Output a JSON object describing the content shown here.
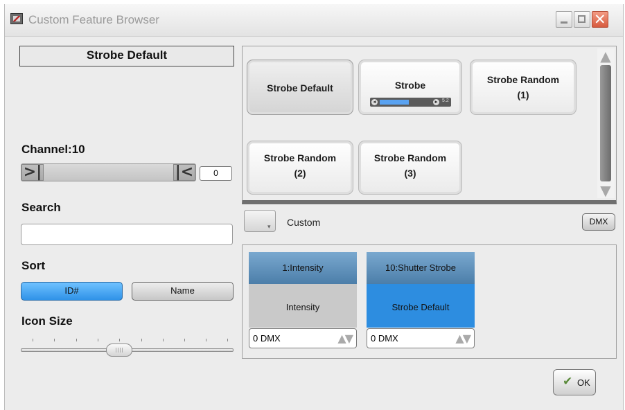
{
  "window": {
    "title": "Custom Feature Browser"
  },
  "left": {
    "current_feature": "Strobe Default",
    "channel_label": "Channel:10",
    "channel_value": "0",
    "search_label": "Search",
    "search_value": "",
    "sort_label": "Sort",
    "sort_id": "ID#",
    "sort_name": "Name",
    "sort_selected": "ID#",
    "icon_size_label": "Icon Size"
  },
  "features": [
    {
      "label": "Strobe Default",
      "selected": true
    },
    {
      "label": "Strobe",
      "slider_value": "5.2"
    },
    {
      "line1": "Strobe Random",
      "line2": "(1)"
    },
    {
      "line1": "Strobe Random",
      "line2": "(2)"
    },
    {
      "line1": "Strobe Random",
      "line2": "(3)"
    }
  ],
  "options": {
    "mode_label": "Custom",
    "dmx_button": "DMX"
  },
  "channels": [
    {
      "header": "1:Intensity",
      "value": "Intensity",
      "dmx": "0 DMX",
      "arrows": "▲▼"
    },
    {
      "header": "10:Shutter Strobe",
      "value": "Strobe Default",
      "dmx": "0 DMX",
      "arrows": "▲▼"
    }
  ],
  "footer": {
    "ok_label": "OK"
  },
  "colors": {
    "accent_blue": "#2d8de0",
    "header_blue": "#5e8fbb",
    "close_red": "#d75b3f"
  }
}
